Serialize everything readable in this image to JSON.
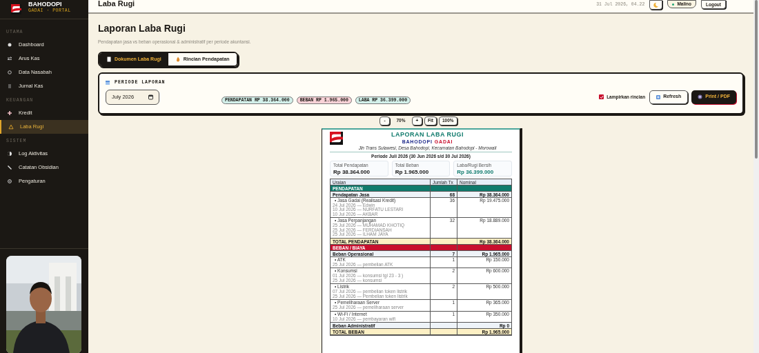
{
  "sidebar": {
    "brand": "BAHODOPI",
    "tagline": "GADAI · PORTAL",
    "sections": [
      {
        "label": "UTAMA",
        "items": [
          {
            "label": "Dashboard",
            "selected": false
          },
          {
            "label": "Arus Kas",
            "selected": false
          },
          {
            "label": "Data Nasabah",
            "selected": false
          },
          {
            "label": "Jurnal Kas",
            "selected": false
          }
        ]
      },
      {
        "label": "KEUANGAN",
        "items": [
          {
            "label": "Kredit",
            "selected": false
          },
          {
            "label": "Laba Rugi",
            "selected": true
          }
        ]
      },
      {
        "label": "SISTEM",
        "items": [
          {
            "label": "Log Aktivitas",
            "selected": false
          },
          {
            "label": "Catatan Obsidian",
            "selected": false
          },
          {
            "label": "Pengaturan",
            "selected": false
          }
        ]
      }
    ]
  },
  "header": {
    "title": "Laba Rugi",
    "datetime": "31 Jul 2026, 04.22",
    "user": "Malino",
    "user_online": true,
    "logout": "Logout"
  },
  "page": {
    "title": "Laporan Laba Rugi",
    "subtitle": "Pendapatan jasa vs beban operasional & administratif per periode akuntansi.",
    "tabs": [
      {
        "label": "Dokumen Laba Rugi",
        "selected": true
      },
      {
        "label": "Rincian Pendapatan",
        "selected": false
      }
    ]
  },
  "period": {
    "label": "PERIODE LAPORAN",
    "value": "July 2026",
    "chips": [
      {
        "label": "PENDAPATAN RP 38.364.000",
        "color": "#d3f0ea"
      },
      {
        "label": "BEBAN RP 1.965.000",
        "color": "#f9d2d7"
      },
      {
        "label": "LABA RP 36.399.000",
        "color": "#d3f0ea"
      }
    ],
    "attach": {
      "label": "Lampirkan rincian",
      "checked": true
    },
    "refresh": "Refresh",
    "print": "Print / PDF"
  },
  "zoom": {
    "minus": "-",
    "level": "70%",
    "plus": "+",
    "fit": "Fit",
    "full": "100%"
  },
  "document": {
    "title": "LAPORAN LABA RUGI",
    "brand": "BAHODOPI",
    "brand_suffix": "GADAI",
    "address": "Jln Trans Sulawesi, Desa Bahodopi, Kecamatan Bahodopi - Morowali",
    "period": "Periode Juli 2026 (30 Jun 2026 s/d 30 Jul 2026)",
    "summary": [
      {
        "label": "Total Pendapatan",
        "value": "Rp 38.364.000",
        "positive": false
      },
      {
        "label": "Total Beban",
        "value": "Rp 1.965.000",
        "positive": false
      },
      {
        "label": "Laba/Rugi Bersih",
        "value": "Rp 36.399.000",
        "positive": true
      }
    ],
    "columns": [
      "Uraian",
      "Jumlah Tx",
      "Nominal"
    ],
    "rows": [
      {
        "kind": "section",
        "label": "PENDAPATAN",
        "color": "#0f7a6c"
      },
      {
        "kind": "group",
        "label": "Pendapatan Jasa",
        "count": "68",
        "amount": "Rp 38.364.000"
      },
      {
        "kind": "item",
        "label": "• Jasa Gadai (Realisasi Kredit)",
        "count": "36",
        "amount": "Rp 19.475.000",
        "details": [
          "24 Jul 2026 — Edwin",
          "10 Jul 2026 — NURFATU LESTARI",
          "10 Jul 2026 — AKBAR"
        ]
      },
      {
        "kind": "item",
        "label": "• Jasa Perpanjangan",
        "count": "32",
        "amount": "Rp 18.889.000",
        "details": [
          "25 Jul 2026 — MUHAMAD KHOTIQ",
          "25 Jul 2026 — FERDIANSAH",
          "25 Jul 2026 — ILHAM JAYA"
        ]
      },
      {
        "kind": "total",
        "label": "TOTAL PENDAPATAN",
        "amount": "Rp 38.364.000"
      },
      {
        "kind": "section",
        "label": "BEBAN / BIAYA",
        "color": "#c8102e"
      },
      {
        "kind": "group",
        "label": "Beban Operasional",
        "count": "7",
        "amount": "Rp 1.965.000"
      },
      {
        "kind": "item",
        "label": "• ATK",
        "count": "1",
        "amount": "Rp 150.000",
        "details": [
          "25 Jul 2026 — pembelian ATK"
        ]
      },
      {
        "kind": "item",
        "label": "• Konsumsi",
        "count": "2",
        "amount": "Rp 600.000",
        "details": [
          "01 Jul 2026 — konsumsi tgl 23 - 3 )",
          "25 Jul 2026 — konsumsi"
        ]
      },
      {
        "kind": "item",
        "label": "• Listrik",
        "count": "2",
        "amount": "Rp 500.000",
        "details": [
          "07 Jul 2026 — pembelian token listrik",
          "25 Jul 2026 — Pembelian token listrik"
        ]
      },
      {
        "kind": "item",
        "label": "• Pemeliharaan Server",
        "count": "1",
        "amount": "Rp 365.000",
        "details": [
          "25 Jul 2026 — pemeliharaan server"
        ]
      },
      {
        "kind": "item",
        "label": "• Wi-Fi / Internet",
        "count": "1",
        "amount": "Rp 350.000",
        "details": [
          "10 Jul 2026 — pembayaran wifi"
        ]
      },
      {
        "kind": "group",
        "label": "Beban Administratif",
        "amount": "Rp 0"
      },
      {
        "kind": "total",
        "label": "TOTAL BEBAN",
        "amount": "Rp 1.965.000"
      }
    ]
  }
}
